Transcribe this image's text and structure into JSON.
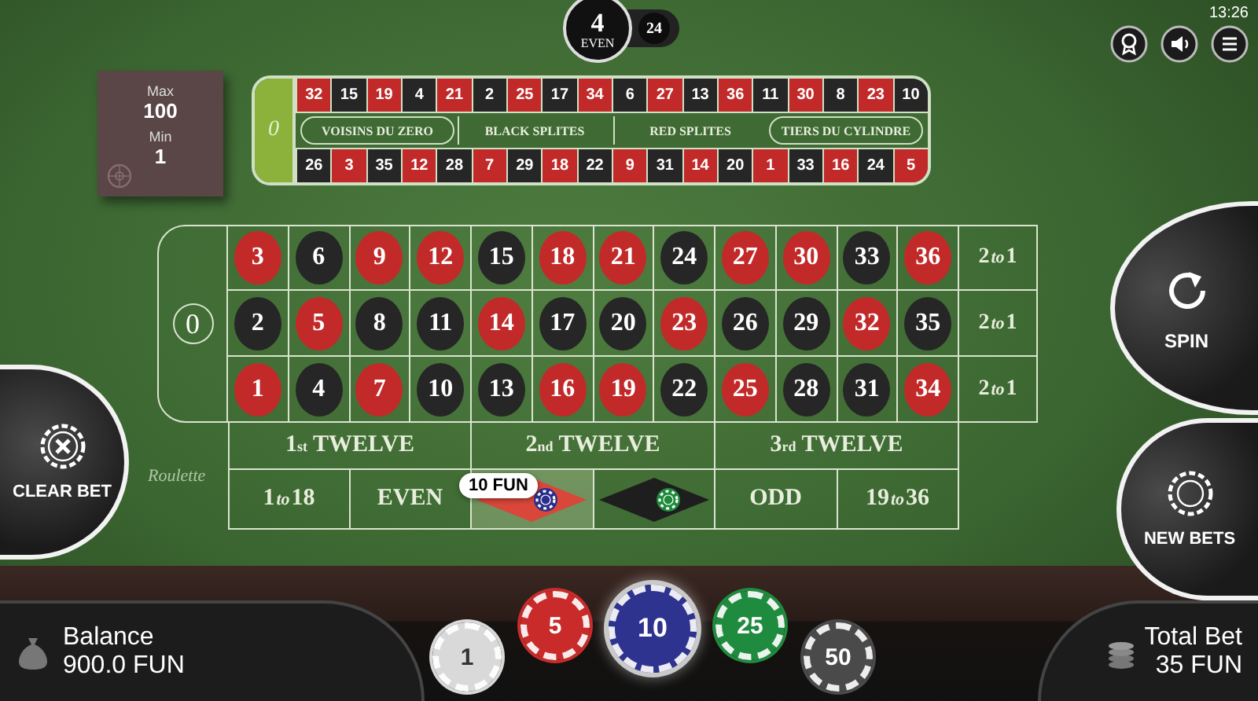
{
  "top_bar": {
    "last_result": {
      "number": "4",
      "label": "EVEN"
    },
    "previous_result": "24",
    "time": "13:26"
  },
  "limits": {
    "max_label": "Max",
    "max": "100",
    "min_label": "Min",
    "min": "1"
  },
  "racetrack": {
    "zero": "0",
    "top": [
      {
        "n": "32",
        "color": "#c22a2a"
      },
      {
        "n": "15",
        "color": "#262626"
      },
      {
        "n": "19",
        "color": "#c22a2a"
      },
      {
        "n": "4",
        "color": "#262626"
      },
      {
        "n": "21",
        "color": "#c22a2a"
      },
      {
        "n": "2",
        "color": "#262626"
      },
      {
        "n": "25",
        "color": "#c22a2a"
      },
      {
        "n": "17",
        "color": "#262626"
      },
      {
        "n": "34",
        "color": "#c22a2a"
      },
      {
        "n": "6",
        "color": "#262626"
      },
      {
        "n": "27",
        "color": "#c22a2a"
      },
      {
        "n": "13",
        "color": "#262626"
      },
      {
        "n": "36",
        "color": "#c22a2a"
      },
      {
        "n": "11",
        "color": "#262626"
      },
      {
        "n": "30",
        "color": "#c22a2a"
      },
      {
        "n": "8",
        "color": "#262626"
      },
      {
        "n": "23",
        "color": "#c22a2a"
      },
      {
        "n": "10",
        "color": "#262626"
      }
    ],
    "sections": [
      {
        "label": "VOISINS DU ZERO",
        "kind": "pill"
      },
      {
        "label": "BLACK SPLITES",
        "kind": "plain"
      },
      {
        "label": "RED SPLITES",
        "kind": "plain"
      },
      {
        "label": "TIERS DU CYLINDRE",
        "kind": "pill"
      }
    ],
    "bottom": [
      {
        "n": "26",
        "color": "#262626"
      },
      {
        "n": "3",
        "color": "#c22a2a"
      },
      {
        "n": "35",
        "color": "#262626"
      },
      {
        "n": "12",
        "color": "#c22a2a"
      },
      {
        "n": "28",
        "color": "#262626"
      },
      {
        "n": "7",
        "color": "#c22a2a"
      },
      {
        "n": "29",
        "color": "#262626"
      },
      {
        "n": "18",
        "color": "#c22a2a"
      },
      {
        "n": "22",
        "color": "#262626"
      },
      {
        "n": "9",
        "color": "#c22a2a"
      },
      {
        "n": "31",
        "color": "#262626"
      },
      {
        "n": "14",
        "color": "#c22a2a"
      },
      {
        "n": "20",
        "color": "#262626"
      },
      {
        "n": "1",
        "color": "#c22a2a"
      },
      {
        "n": "33",
        "color": "#262626"
      },
      {
        "n": "16",
        "color": "#c22a2a"
      },
      {
        "n": "24",
        "color": "#262626"
      },
      {
        "n": "5",
        "color": "#c22a2a"
      }
    ]
  },
  "table": {
    "zero": "0",
    "table_logo": "Roulette",
    "rows": [
      [
        {
          "n": "3",
          "color": "#c22a2a"
        },
        {
          "n": "6",
          "color": "#262626"
        },
        {
          "n": "9",
          "color": "#c22a2a"
        },
        {
          "n": "12",
          "color": "#c22a2a"
        },
        {
          "n": "15",
          "color": "#262626"
        },
        {
          "n": "18",
          "color": "#c22a2a"
        },
        {
          "n": "21",
          "color": "#c22a2a"
        },
        {
          "n": "24",
          "color": "#262626"
        },
        {
          "n": "27",
          "color": "#c22a2a"
        },
        {
          "n": "30",
          "color": "#c22a2a"
        },
        {
          "n": "33",
          "color": "#262626"
        },
        {
          "n": "36",
          "color": "#c22a2a"
        }
      ],
      [
        {
          "n": "2",
          "color": "#262626"
        },
        {
          "n": "5",
          "color": "#c22a2a"
        },
        {
          "n": "8",
          "color": "#262626"
        },
        {
          "n": "11",
          "color": "#262626"
        },
        {
          "n": "14",
          "color": "#c22a2a"
        },
        {
          "n": "17",
          "color": "#262626"
        },
        {
          "n": "20",
          "color": "#262626"
        },
        {
          "n": "23",
          "color": "#c22a2a"
        },
        {
          "n": "26",
          "color": "#262626"
        },
        {
          "n": "29",
          "color": "#262626"
        },
        {
          "n": "32",
          "color": "#c22a2a"
        },
        {
          "n": "35",
          "color": "#262626"
        }
      ],
      [
        {
          "n": "1",
          "color": "#c22a2a"
        },
        {
          "n": "4",
          "color": "#262626"
        },
        {
          "n": "7",
          "color": "#c22a2a"
        },
        {
          "n": "10",
          "color": "#262626"
        },
        {
          "n": "13",
          "color": "#262626"
        },
        {
          "n": "16",
          "color": "#c22a2a"
        },
        {
          "n": "19",
          "color": "#c22a2a"
        },
        {
          "n": "22",
          "color": "#262626"
        },
        {
          "n": "25",
          "color": "#c22a2a"
        },
        {
          "n": "28",
          "color": "#262626"
        },
        {
          "n": "31",
          "color": "#262626"
        },
        {
          "n": "34",
          "color": "#c22a2a"
        }
      ]
    ],
    "column_bets": [
      {
        "from": "2",
        "word": "to",
        "upto": "1"
      },
      {
        "from": "2",
        "word": "to",
        "upto": "1"
      },
      {
        "from": "2",
        "word": "to",
        "upto": "1"
      }
    ],
    "dozens": [
      {
        "ordinal": "1",
        "suffix": "st",
        "label": "TWELVE"
      },
      {
        "ordinal": "2",
        "suffix": "nd",
        "label": "TWELVE"
      },
      {
        "ordinal": "3",
        "suffix": "rd",
        "label": "TWELVE"
      }
    ],
    "outside": [
      {
        "kind": "range",
        "from": "1",
        "word": "to",
        "upto": "18"
      },
      {
        "kind": "text",
        "label": "EVEN"
      },
      {
        "kind": "diamond",
        "color": "#d8473a",
        "selected": true,
        "chip": {
          "color": "#2b2f8c"
        },
        "tooltip": "10 FUN"
      },
      {
        "kind": "diamond",
        "color": "#1e1e1e",
        "selected": false,
        "chip": {
          "color": "#1f8a3c"
        }
      },
      {
        "kind": "text",
        "label": "ODD"
      },
      {
        "kind": "range",
        "from": "19",
        "word": "to",
        "upto": "36"
      }
    ]
  },
  "controls": {
    "clear_bet": "CLEAR BET",
    "spin": "SPIN",
    "new_bets": "NEW BETS"
  },
  "footer": {
    "balance_label": "Balance",
    "balance": "900.0 FUN",
    "chips": [
      {
        "value": "1",
        "color": "#d9d9d9",
        "selected": false
      },
      {
        "value": "5",
        "color": "#c92a2a",
        "selected": false
      },
      {
        "value": "10",
        "color": "#2e338f",
        "selected": true
      },
      {
        "value": "25",
        "color": "#1e8b3e",
        "selected": false
      },
      {
        "value": "50",
        "color": "#4a4a4a",
        "selected": false
      }
    ],
    "total_label": "Total Bet",
    "total": "35 FUN"
  }
}
